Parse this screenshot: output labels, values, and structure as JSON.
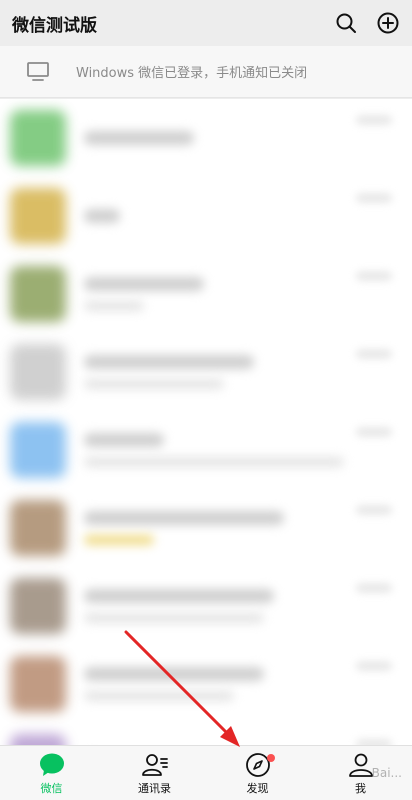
{
  "header": {
    "title": "微信测试版",
    "search_icon": "search-icon",
    "add_icon": "plus-circle-icon"
  },
  "notice": {
    "icon": "desktop-icon",
    "text": "Windows 微信已登录，手机通知已关闭"
  },
  "tabs": [
    {
      "label": "微信",
      "icon": "chat-bubble-icon",
      "active": true
    },
    {
      "label": "通讯录",
      "icon": "contacts-icon",
      "active": false
    },
    {
      "label": "发现",
      "icon": "compass-icon",
      "active": false,
      "badge": true
    },
    {
      "label": "我",
      "icon": "person-icon",
      "active": false
    }
  ],
  "colors": {
    "accent": "#07c160",
    "badge": "#fa5151",
    "arrow": "#e32626"
  },
  "watermark": "Bai..."
}
